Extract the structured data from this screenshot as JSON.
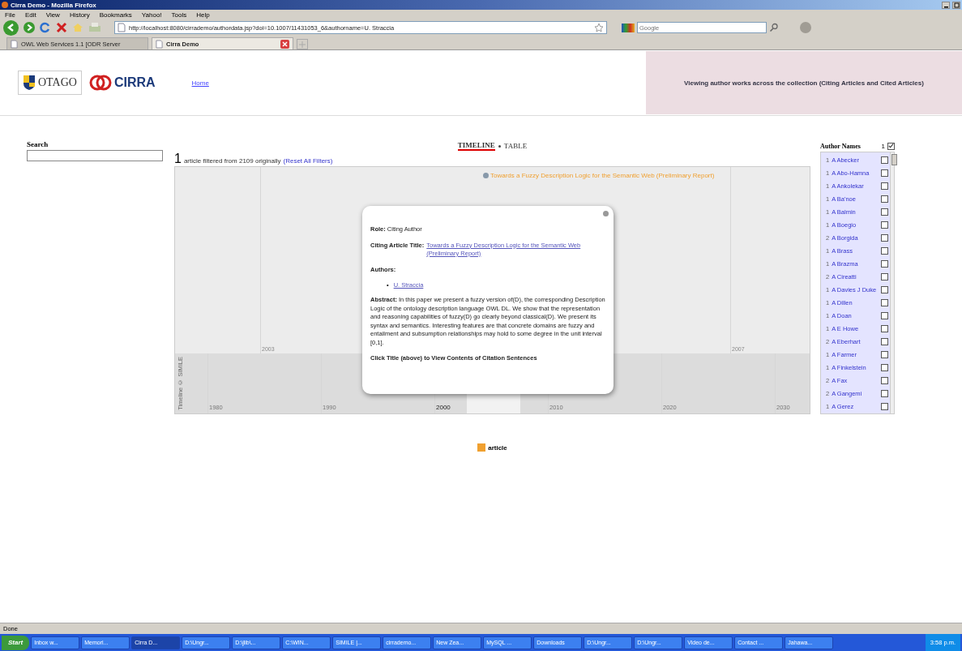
{
  "window": {
    "title": "Cirra Demo - Mozilla Firefox"
  },
  "menu": [
    "File",
    "Edit",
    "View",
    "History",
    "Bookmarks",
    "Yahoo!",
    "Tools",
    "Help"
  ],
  "address_bar": {
    "value": "http://localhost:8080/cirrademo/authordata.jsp?doi=10.1007/11431053_6&authorname=U. Straccia"
  },
  "search_box": {
    "placeholder": "Google"
  },
  "tabs": [
    {
      "label": "OWL Web Services 1.1 [ODR Server",
      "selected": false
    },
    {
      "label": "Cirra Demo",
      "selected": true
    }
  ],
  "header": {
    "university": "OTAGO",
    "logo_text": "CIRRA",
    "home_link": "Home",
    "banner": "Viewing author works across the collection (Citing Articles and Cited Articles)"
  },
  "search": {
    "label": "Search"
  },
  "view_switch": [
    {
      "label": "TIMELINE",
      "selected": true
    },
    {
      "label": "TABLE",
      "selected": false
    }
  ],
  "filter": {
    "count": "1",
    "text": "article filtered from 2109 originally",
    "reset_link": "(Reset All Filters)"
  },
  "timeline": {
    "upper_years": [
      "2003",
      "2007"
    ],
    "lower_years": [
      {
        "label": "1980",
        "selected": false
      },
      {
        "label": "1990",
        "selected": false
      },
      {
        "label": "2000",
        "selected": true
      },
      {
        "label": "2010",
        "selected": false
      },
      {
        "label": "2020",
        "selected": false
      },
      {
        "label": "2030",
        "selected": false
      }
    ],
    "credit": "Timeline © SIMILE",
    "event_title": "Towards a Fuzzy Description Logic for the Semantic Web (Preliminary Report)",
    "popup": {
      "role": "**Role:** Citing Author",
      "title_label": "Citing Article Title:",
      "title_link": "Towards a Fuzzy Description Logic for the Semantic Web (Preliminary Report)",
      "authors_label": "Authors:",
      "authors": [
        {
          "bullet": "•",
          "name": "U. Straccia"
        }
      ],
      "abstract": "**Abstract:** In this paper we present a fuzzy version of(D), the corresponding Description Logic of the ontology description language OWL DL. We show that the representation and reasoning capabilities of fuzzy(D) go clearly beyond classical(D). We present its syntax and semantics. Interesting features are that concrete domains are fuzzy and entailment and subsumption relationships may hold to some degree in the unit interval [0,1].",
      "footer": "Click Title (above) to View Contents of Citation Sentences"
    }
  },
  "legend": [
    {
      "label": "article",
      "color": "#f0a030"
    }
  ],
  "authors_panel": {
    "title": "Author Names",
    "count": "1",
    "checked": true,
    "items": [
      {
        "count": "1",
        "name": "A Abecker",
        "checked": false
      },
      {
        "count": "1",
        "name": "A Abo-Hamna",
        "checked": false
      },
      {
        "count": "1",
        "name": "A Ankolekar",
        "checked": false
      },
      {
        "count": "1",
        "name": "A Ba'noe",
        "checked": false
      },
      {
        "count": "1",
        "name": "A Balmin",
        "checked": false
      },
      {
        "count": "1",
        "name": "A Boegio",
        "checked": false
      },
      {
        "count": "2",
        "name": "A Borgida",
        "checked": false
      },
      {
        "count": "1",
        "name": "A Brass",
        "checked": false
      },
      {
        "count": "1",
        "name": "A Brazma",
        "checked": false
      },
      {
        "count": "2",
        "name": "A Cireatti",
        "checked": false
      },
      {
        "count": "1",
        "name": "A Davies J Duke",
        "checked": false
      },
      {
        "count": "1",
        "name": "A Dillen",
        "checked": false
      },
      {
        "count": "1",
        "name": "A Doan",
        "checked": false
      },
      {
        "count": "1",
        "name": "A E Howe",
        "checked": false
      },
      {
        "count": "2",
        "name": "A Eberhart",
        "checked": false
      },
      {
        "count": "1",
        "name": "A Farmer",
        "checked": false
      },
      {
        "count": "1",
        "name": "A Finkelstein",
        "checked": false
      },
      {
        "count": "2",
        "name": "A Fax",
        "checked": false
      },
      {
        "count": "2",
        "name": "A Gangemi",
        "checked": false
      },
      {
        "count": "1",
        "name": "A Gerez",
        "checked": false
      }
    ]
  },
  "status_bar": "Done",
  "taskbar": {
    "start": "Start",
    "items": [
      {
        "label": "Inbox w...",
        "selected": false
      },
      {
        "label": "Memori...",
        "selected": false
      },
      {
        "label": "Cirra D...",
        "selected": true
      },
      {
        "label": "D:\\Ungr...",
        "selected": false
      },
      {
        "label": "D:\\jlib\\...",
        "selected": false
      },
      {
        "label": "C:\\WIN...",
        "selected": false
      },
      {
        "label": "SIMILE |...",
        "selected": false
      },
      {
        "label": "cirrademo...",
        "selected": false
      },
      {
        "label": "New Zea...",
        "selected": false
      },
      {
        "label": "MySQL ...",
        "selected": false
      },
      {
        "label": "Downloads",
        "selected": false
      },
      {
        "label": "D:\\Ungr...",
        "selected": false
      },
      {
        "label": "D:\\Ungr...",
        "selected": false
      },
      {
        "label": "Video de...",
        "selected": false
      },
      {
        "label": "Contact ...",
        "selected": false
      },
      {
        "label": "Jahawa...",
        "selected": false
      }
    ],
    "clock": "3:58 p.m."
  }
}
